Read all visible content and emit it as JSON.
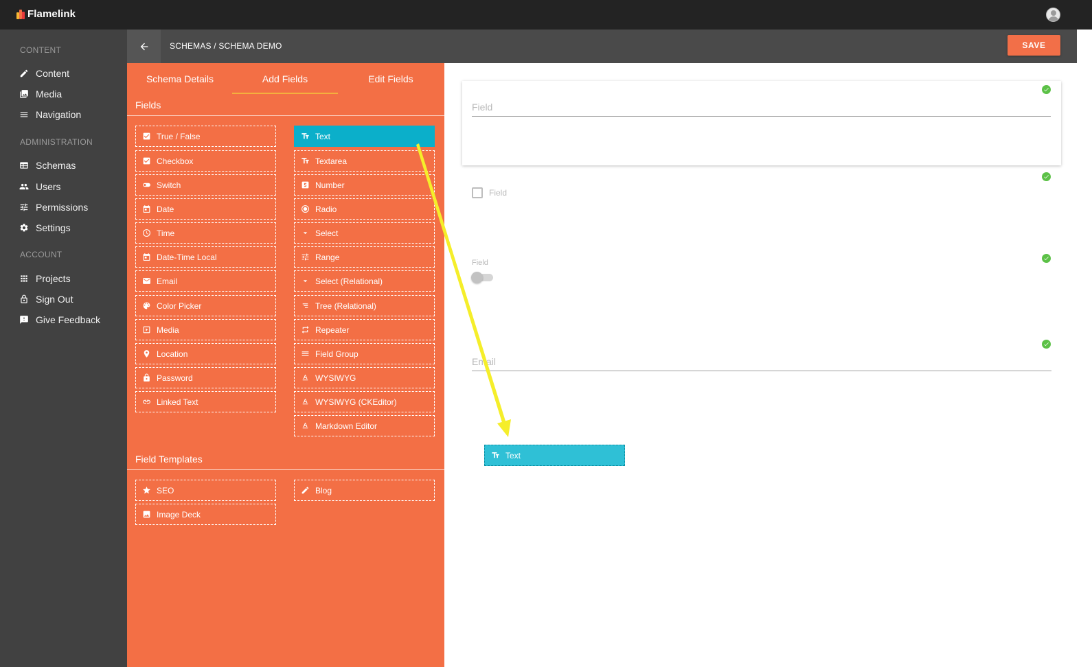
{
  "app": {
    "name": "Flamelink"
  },
  "colors": {
    "accent": "#f36f45",
    "active_field": "#0bafca",
    "sidebar": "#414141",
    "topbar": "#232323",
    "success": "#5cc147",
    "annotation_arrow": "#f5ee2a"
  },
  "sidebar": {
    "sections": [
      {
        "label": "CONTENT",
        "items": [
          {
            "label": "Content",
            "icon": "pencil-icon"
          },
          {
            "label": "Media",
            "icon": "image-icon"
          },
          {
            "label": "Navigation",
            "icon": "menu-icon"
          }
        ]
      },
      {
        "label": "ADMINISTRATION",
        "items": [
          {
            "label": "Schemas",
            "icon": "schema-icon"
          },
          {
            "label": "Users",
            "icon": "users-icon"
          },
          {
            "label": "Permissions",
            "icon": "sliders-icon"
          },
          {
            "label": "Settings",
            "icon": "gear-icon"
          }
        ]
      },
      {
        "label": "ACCOUNT",
        "items": [
          {
            "label": "Projects",
            "icon": "apps-grid-icon"
          },
          {
            "label": "Sign Out",
            "icon": "lock-icon"
          },
          {
            "label": "Give Feedback",
            "icon": "feedback-icon"
          }
        ]
      }
    ]
  },
  "header": {
    "breadcrumb": "SCHEMAS / SCHEMA DEMO",
    "save_label": "SAVE"
  },
  "tabs": [
    {
      "label": "Schema Details",
      "active": false
    },
    {
      "label": "Add Fields",
      "active": true
    },
    {
      "label": "Edit Fields",
      "active": false
    }
  ],
  "fields": {
    "title": "Fields",
    "left": [
      {
        "label": "True / False",
        "icon": "checkbox-icon"
      },
      {
        "label": "Checkbox",
        "icon": "checkbox-icon"
      },
      {
        "label": "Switch",
        "icon": "toggle-icon"
      },
      {
        "label": "Date",
        "icon": "calendar-icon"
      },
      {
        "label": "Time",
        "icon": "clock-icon"
      },
      {
        "label": "Date-Time Local",
        "icon": "calendar-icon"
      },
      {
        "label": "Email",
        "icon": "mail-icon"
      },
      {
        "label": "Color Picker",
        "icon": "palette-icon"
      },
      {
        "label": "Media",
        "icon": "slideshow-icon"
      },
      {
        "label": "Location",
        "icon": "pin-icon"
      },
      {
        "label": "Password",
        "icon": "lock-icon"
      },
      {
        "label": "Linked Text",
        "icon": "link-icon"
      }
    ],
    "right": [
      {
        "label": "Text",
        "icon": "text-icon",
        "active": true
      },
      {
        "label": "Textarea",
        "icon": "text-icon"
      },
      {
        "label": "Number",
        "icon": "number-icon"
      },
      {
        "label": "Radio",
        "icon": "radio-icon"
      },
      {
        "label": "Select",
        "icon": "caret-down-icon"
      },
      {
        "label": "Range",
        "icon": "sliders-icon"
      },
      {
        "label": "Select (Relational)",
        "icon": "caret-down-icon"
      },
      {
        "label": "Tree (Relational)",
        "icon": "tree-icon"
      },
      {
        "label": "Repeater",
        "icon": "repeat-icon"
      },
      {
        "label": "Field Group",
        "icon": "menu-icon"
      },
      {
        "label": "WYSIWYG",
        "icon": "format-text-icon"
      },
      {
        "label": "WYSIWYG (CKEditor)",
        "icon": "format-text-icon"
      },
      {
        "label": "Markdown Editor",
        "icon": "format-text-icon"
      }
    ]
  },
  "templates": {
    "title": "Field Templates",
    "left": [
      {
        "label": "SEO",
        "icon": "star-icon"
      },
      {
        "label": "Image Deck",
        "icon": "image-icon"
      }
    ],
    "right": [
      {
        "label": "Blog",
        "icon": "pencil-icon"
      }
    ]
  },
  "preview": {
    "text_field_placeholder": "Field",
    "checkbox_label": "Field",
    "switch_label": "Field",
    "email_placeholder": "Email"
  },
  "drag_ghost": {
    "label": "Text",
    "icon": "text-icon"
  }
}
